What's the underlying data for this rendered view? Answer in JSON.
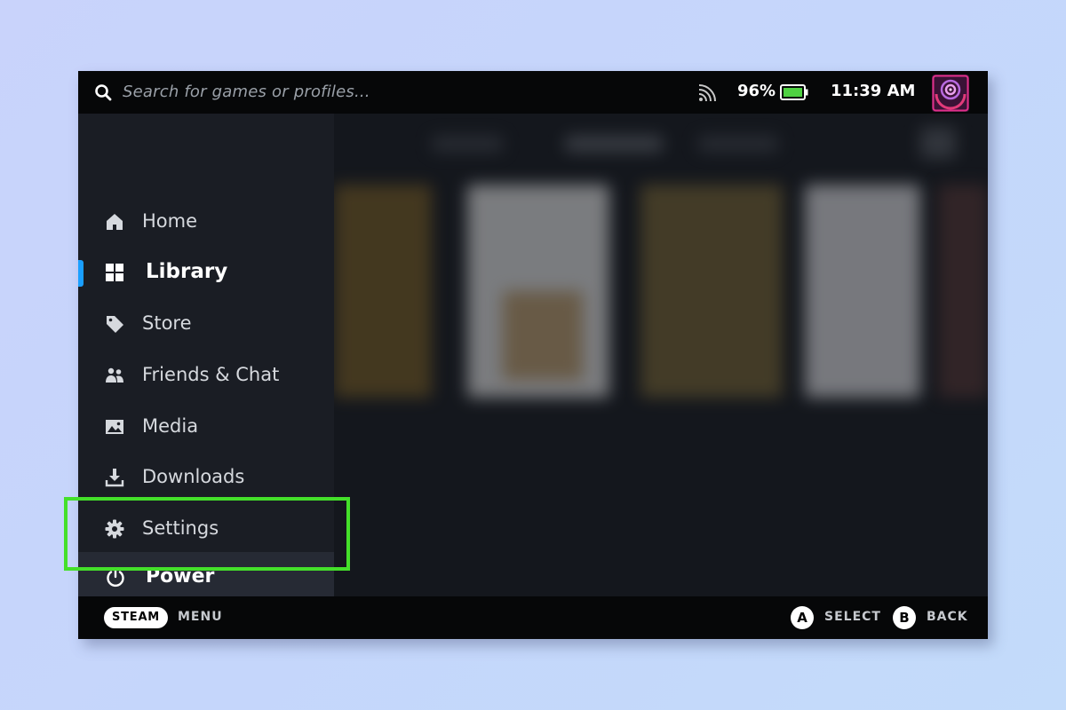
{
  "topbar": {
    "search_placeholder": "Search for games or profiles...",
    "battery_percent": "96%",
    "clock": "11:39 AM",
    "icons": [
      "search-icon",
      "cast-icon",
      "battery-icon",
      "avatar"
    ]
  },
  "sidebar": {
    "items": [
      {
        "label": "Home",
        "icon": "home-icon"
      },
      {
        "label": "Library",
        "icon": "grid-icon",
        "active": true
      },
      {
        "label": "Store",
        "icon": "tag-icon"
      },
      {
        "label": "Friends & Chat",
        "icon": "people-icon"
      },
      {
        "label": "Media",
        "icon": "image-icon"
      },
      {
        "label": "Downloads",
        "icon": "download-icon"
      },
      {
        "label": "Settings",
        "icon": "gear-icon"
      },
      {
        "label": "Power",
        "icon": "power-icon",
        "focused": true
      }
    ]
  },
  "bottombar": {
    "steam_label": "STEAM",
    "menu_label": "MENU",
    "a_button": "A",
    "select_label": "SELECT",
    "b_button": "B",
    "back_label": "BACK"
  },
  "colors": {
    "accent": "#1a9fff",
    "highlight": "#44e02a",
    "battery": "#4fd142"
  }
}
